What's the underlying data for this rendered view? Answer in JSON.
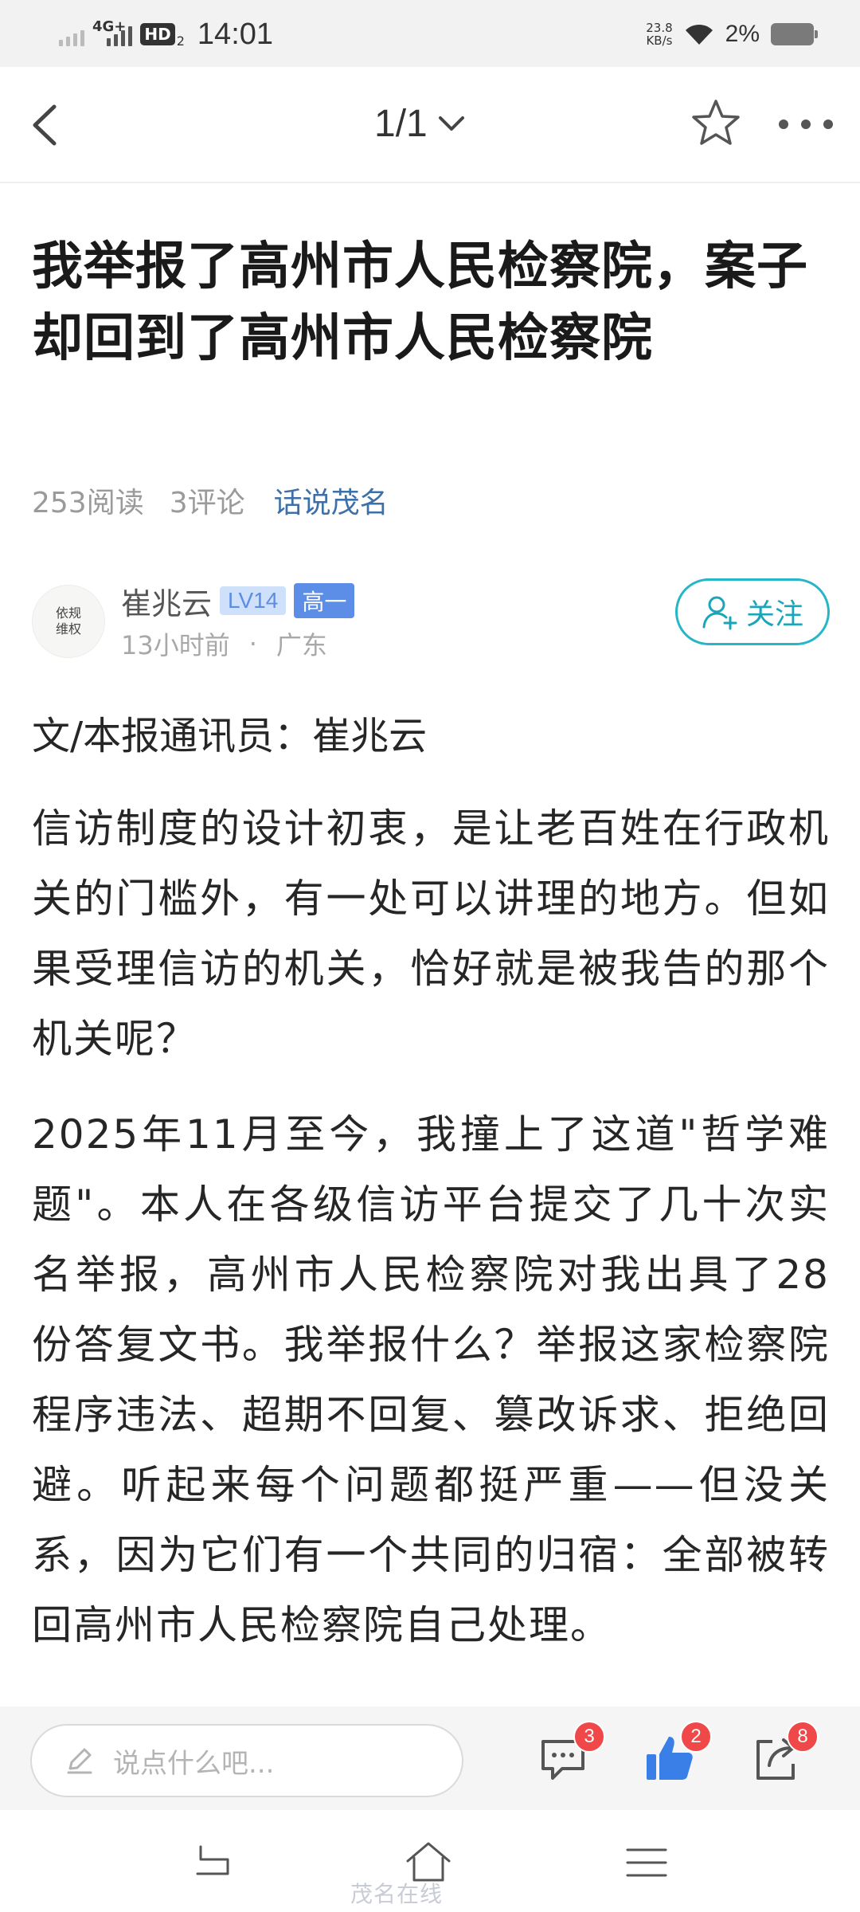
{
  "status_bar": {
    "network": "4G+",
    "hd": "HD",
    "hd_sub": "2",
    "time": "14:01",
    "speed_value": "23.8",
    "speed_unit": "KB/s",
    "battery": "2%"
  },
  "header": {
    "page_indicator": "1/1"
  },
  "article": {
    "title": "我举报了高州市人民检察院，案子却回到了高州市人民检察院",
    "reads": "253阅读",
    "comments": "3评论",
    "topic": "话说茂名"
  },
  "author": {
    "avatar_text": "依规维权",
    "name": "崔兆云",
    "level": "LV14",
    "grade": "高一",
    "time": "13小时前",
    "dot": "·",
    "location": "广东",
    "follow_label": "关注"
  },
  "body": {
    "byline": "文/本报通讯员：崔兆云",
    "paragraph1": "信访制度的设计初衷，是让老百姓在行政机关的门槛外，有一处可以讲理的地方。但如果受理信访的机关，恰好就是被我告的那个机关呢？",
    "paragraph2": "2025年11月至今，我撞上了这道\"哲学难题\"。本人在各级信访平台提交了几十次实名举报，高州市人民检察院对我出具了28份答复文书。我举报什么？举报这家检察院程序违法、超期不回复、篡改诉求、拒绝回避。听起来每个问题都挺严重——但没关系，因为它们有一个共同的归宿：全部被转回高州市人民检察院自己处理。"
  },
  "comment_bar": {
    "placeholder": "说点什么吧...",
    "comment_count": "3",
    "like_count": "2",
    "share_count": "8"
  },
  "watermark": "茂名在线",
  "colors": {
    "accent": "#27b6c7",
    "topic": "#3d6fa8",
    "badge_red": "#f04848",
    "like_blue": "#3a7ee8"
  }
}
